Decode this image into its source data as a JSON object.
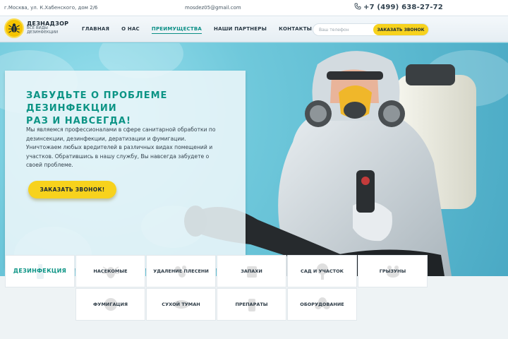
{
  "topbar": {
    "address": "г.Москва, ул. К.Хабенского, дом 2/6",
    "email": "mosdez05@gmail.com",
    "phone": "+7 (499) 638-27-72"
  },
  "logo": {
    "name": "ДЕЗНАДЗОР",
    "tagline_1": "ВСЕ ВИДЫ",
    "tagline_2": "ДЕЗИНФЕКЦИИ"
  },
  "nav": {
    "items": [
      {
        "label": "ГЛАВНАЯ"
      },
      {
        "label": "О НАС"
      },
      {
        "label": "ПРЕИМУЩЕСТВА"
      },
      {
        "label": "НАШИ ПАРТНЕРЫ"
      },
      {
        "label": "КОНТАКТЫ"
      }
    ],
    "active_index": 2
  },
  "callback_form": {
    "placeholder": "Ваш телефон",
    "button_label": "ЗАКАЗАТЬ ЗВОНОК"
  },
  "hero": {
    "title_line_1": "ЗАБУДЬТЕ О ПРОБЛЕМЕ ДЕЗИНФЕКЦИИ",
    "title_line_2": "РАЗ И НАВСЕГДА!",
    "text": "Мы являемся профессионалами в сфере санитарной обработки по дезинсекции, дезинфекции, дератизации и фумигации. Уничтожаем любых вредителей в различных видах помещений и участков. Обратившись в нашу службу, Вы навсегда забудете о своей проблеме.",
    "cta_label": "ЗАКАЗАТЬ ЗВОНОК!"
  },
  "categories": {
    "row1": [
      {
        "label": "ДЕЗИНФЕКЦИЯ",
        "icon": "spray-bottle-icon"
      },
      {
        "label": "НАСЕКОМЫЕ",
        "icon": "bug-icon"
      },
      {
        "label": "УДАЛЕНИЕ ПЛЕСЕНИ",
        "icon": "mold-icon"
      },
      {
        "label": "ЗАПАХИ",
        "icon": "odor-icon"
      },
      {
        "label": "САД И УЧАСТОК",
        "icon": "tree-icon"
      },
      {
        "label": "ГРЫЗУНЫ",
        "icon": "rodent-icon"
      }
    ],
    "row2": [
      {
        "label": "ФУМИГАЦИЯ",
        "icon": "fumigation-icon"
      },
      {
        "label": "СУХОЙ ТУМАН",
        "icon": "fog-icon"
      },
      {
        "label": "ПРЕПАРАТЫ",
        "icon": "chemicals-icon"
      },
      {
        "label": "ОБОРУДОВАНИЕ",
        "icon": "gas-mask-icon"
      }
    ],
    "active": "ДЕЗИНФЕКЦИЯ"
  },
  "colors": {
    "accent": "#0c9485",
    "button": "#f7d21d",
    "hero_bg": "#6fc8db"
  }
}
